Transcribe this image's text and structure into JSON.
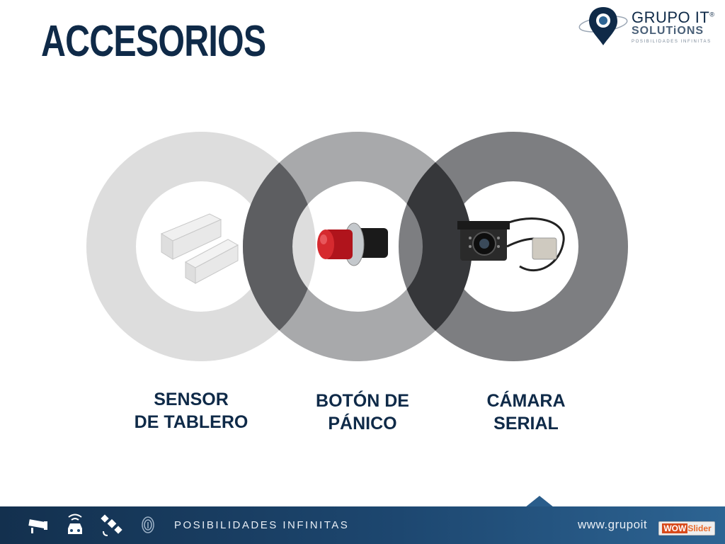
{
  "slide": {
    "title": "ACCESORIOS",
    "logo": {
      "line1": "GRUPO IT",
      "registered": "®",
      "line2": "SOLUTiONS",
      "tagline": "POSIBILIDADES INFINITAS"
    },
    "items": [
      {
        "line1": "SENSOR",
        "line2": "DE TABLERO",
        "image": "door-sensor"
      },
      {
        "line1": "BOTÓN DE",
        "line2": "PÁNICO",
        "image": "panic-button"
      },
      {
        "line1": "CÁMARA",
        "line2": "SERIAL",
        "image": "serial-camera"
      }
    ],
    "ring_colors": [
      "#dddddd",
      "#a8a9ab",
      "#7d7e81"
    ],
    "overlap_color": "#5d5e61",
    "overlap_dark": "#36373a"
  },
  "footer": {
    "tagline": "POSIBILIDADES INFINITAS",
    "site": "www.grupoit",
    "badge_part1": "WOW",
    "badge_part2": "Slider",
    "icons": [
      "cctv-camera-icon",
      "car-wifi-icon",
      "satellite-icon",
      "fingerprint-icon"
    ],
    "bar_color": "#1d4770"
  }
}
